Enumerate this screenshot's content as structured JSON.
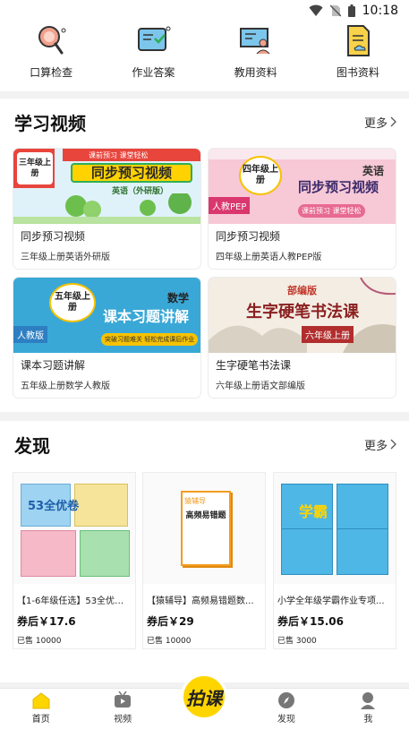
{
  "status": {
    "time": "10:18"
  },
  "tools": [
    {
      "label": "口算检查",
      "icon": "magnifier-icon"
    },
    {
      "label": "作业答案",
      "icon": "answer-book-icon"
    },
    {
      "label": "教用资料",
      "icon": "teacher-board-icon"
    },
    {
      "label": "图书资料",
      "icon": "book-doc-icon"
    }
  ],
  "video_section": {
    "title": "学习视频",
    "more": "更多",
    "cards": [
      {
        "thumb_banner": "课前预习  课堂轻松",
        "thumb_title": "同步预习视频",
        "thumb_sub": "英语（外研版）",
        "grade": "三年级上册",
        "title": "同步预习视频",
        "subtitle": "三年级上册英语外研版"
      },
      {
        "thumb_title": "同步预习视频",
        "thumb_subject": "英语",
        "thumb_banner": "课前预习  课堂轻松",
        "grade": "四年级上册",
        "edition": "人教PEP",
        "title": "同步预习视频",
        "subtitle": "四年级上册英语人教PEP版"
      },
      {
        "thumb_title": "课本习题讲解",
        "thumb_subject": "数学",
        "thumb_banner": "突破习题难关 轻松完成课后作业",
        "grade": "五年级上册",
        "edition": "人教版",
        "title": "课本习题讲解",
        "subtitle": "五年级上册数学人教版"
      },
      {
        "thumb_title": "生字硬笔书法课",
        "thumb_edition": "部编版",
        "thumb_grade": "六年级上册",
        "title": "生字硬笔书法课",
        "subtitle": "六年级上册语文部编版"
      }
    ]
  },
  "find_section": {
    "title": "发现",
    "more": "更多",
    "products": [
      {
        "cover_text": "53全优卷",
        "name": "【1-6年级任选】53全优卷...",
        "price": "券后￥17.6",
        "sold": "已售 10000"
      },
      {
        "cover_text": "高频易错题",
        "cover_brand": "猿辅导",
        "name": "【猿辅导】高频易错题数...",
        "price": "券后￥29",
        "sold": "已售 10000"
      },
      {
        "cover_text": "学霸",
        "name": "小学全年级学霸作业专项...",
        "price": "券后￥15.06",
        "sold": "已售 3000"
      }
    ]
  },
  "tabbar": {
    "home": "首页",
    "video": "视频",
    "camera": "拍课",
    "find": "发现",
    "me": "我"
  },
  "colors": {
    "accent": "#ffd500",
    "brand_green": "#2fae55"
  }
}
